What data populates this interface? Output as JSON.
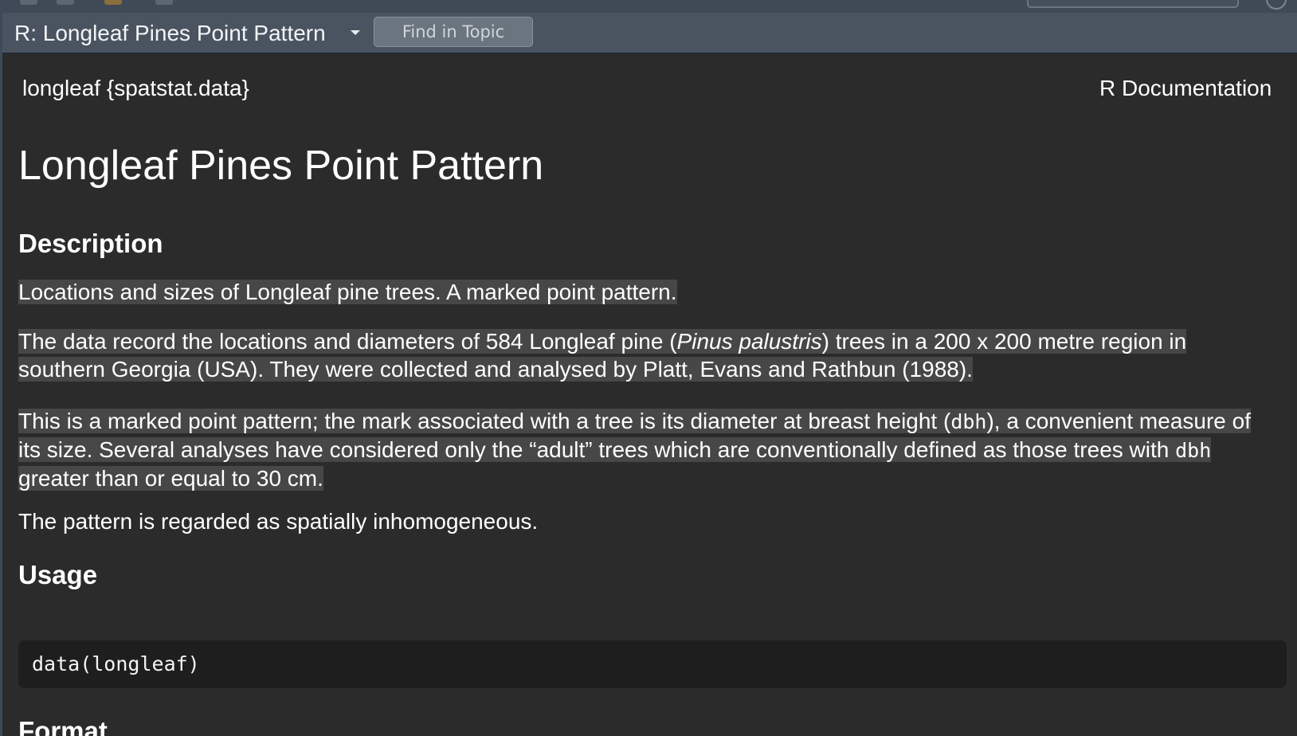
{
  "topic_bar": {
    "title": "R: Longleaf Pines Point Pattern",
    "dropdown_icon": "caret-down-icon",
    "find_button_label": "Find in Topic"
  },
  "document": {
    "package_ref": "longleaf {spatstat.data}",
    "doc_label": "R Documentation",
    "title": "Longleaf Pines Point Pattern",
    "sections": {
      "description": {
        "heading": "Description",
        "p1": "Locations and sizes of Longleaf pine trees. A marked point pattern.",
        "p2_part1": "The data record the locations and diameters of 584 Longleaf pine (",
        "p2_italic": "Pinus palustris",
        "p2_part2": ") trees in a 200 x 200 metre region in southern Georgia (USA). They were collected and analysed by Platt, Evans and Rathbun (1988).",
        "p3_part1": "This is a marked point pattern; the mark associated with a tree is its diameter at breast height (",
        "p3_code1": "dbh",
        "p3_part2": "), a convenient measure of its size. Several analyses have considered only the “adult” trees which are conventionally defined as those trees with ",
        "p3_code2": "dbh",
        "p3_part3": " greater than or equal to 30 cm.",
        "p4": "The pattern is regarded as spatially inhomogeneous."
      },
      "usage": {
        "heading": "Usage",
        "code": "data(longleaf)"
      },
      "format": {
        "heading": "Format"
      }
    }
  },
  "colors": {
    "background": "#2b2b2b",
    "topic_bar": "#4a5460",
    "selection": "#474747",
    "code_block": "#1e1e1e",
    "text": "#ffffff"
  }
}
